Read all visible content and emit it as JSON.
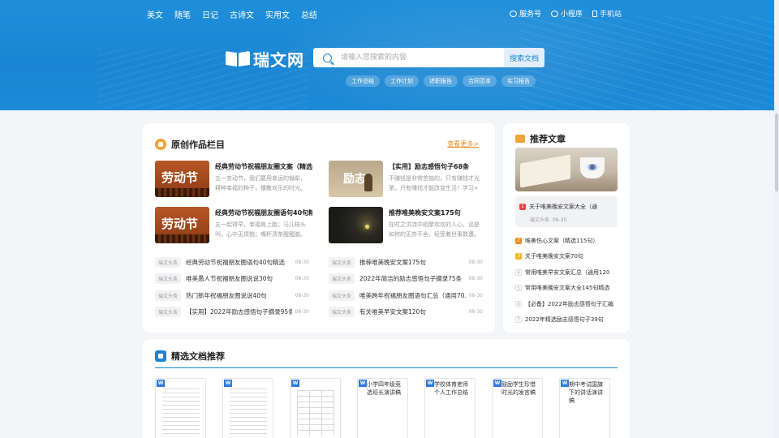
{
  "nav": {
    "left": [
      "美文",
      "随笔",
      "日记",
      "古诗文",
      "实用文",
      "总结"
    ],
    "right": [
      "服务号",
      "小程序",
      "手机站"
    ]
  },
  "brand": {
    "name": "瑞文网"
  },
  "search": {
    "placeholder": "请输入您搜索的内容",
    "button": "搜索文档"
  },
  "hot_tags": [
    "工作总结",
    "工作计划",
    "述职报告",
    "合同范本",
    "实习报告"
  ],
  "original": {
    "title": "原创作品栏目",
    "more": "查看更多>",
    "features": [
      {
        "title": "经典劳动节祝福朋友圈文案（精选",
        "desc": "五一劳动节，我们要用幸运的锄犁，耕种幸福的种子，播散欢乐的时光。",
        "thumb_text": "劳动节"
      },
      {
        "title": "【实用】励志感悟句子68条",
        "desc": "不赚钱是非常苦恼的，只有赚钱才光荣，只有赚钱才能改变生活！学习+",
        "thumb_text": "励志"
      },
      {
        "title": "经典劳动节祝福朋友圈语句40句精",
        "desc": "五一起得早，幸福肩上跑；马儿枝头叫，心中无烦恼；嘴杯清茶醒醒脑。",
        "thumb_text": "劳动节"
      },
      {
        "title": "推荐唯美晚安文案175句",
        "desc": "在时之洪流中相聚欢欢的人心，谈是如何的无奈不舍，经受着世事数遭。",
        "thumb_text": ""
      }
    ],
    "list_left": [
      {
        "badge": "瑞文头条",
        "title": "经典劳动节祝福朋友圈语句40句精选",
        "date": "08-30"
      },
      {
        "badge": "瑞文头条",
        "title": "唯美愚人节祝福朋友圈说说30句",
        "date": "08-30"
      },
      {
        "badge": "瑞文头条",
        "title": "热门新年祝福朋友圈说说40句",
        "date": "08-30"
      },
      {
        "badge": "瑞文头条",
        "title": "【实用】2022年励志感悟句子摘录95条",
        "date": "08-30"
      }
    ],
    "list_right": [
      {
        "badge": "瑞文头条",
        "title": "推荐唯美晚安文案175句",
        "date": "08-30"
      },
      {
        "badge": "瑞文头条",
        "title": "2022年简洁的励志感悟句子摘录75条",
        "date": "08-30"
      },
      {
        "badge": "瑞文头条",
        "title": "唯美跨年祝福朋友圈语句汇总（通用70...",
        "date": "08-30"
      },
      {
        "badge": "瑞文头条",
        "title": "有关唯美早安文案120句",
        "date": "08-30"
      }
    ]
  },
  "recommend": {
    "title": "推荐文章",
    "highlight": {
      "num": "1",
      "title": "关于唯美晚安文案大全（通",
      "source": "瑞文头条",
      "date": "08-30"
    },
    "items": [
      {
        "num": "2",
        "title": "唯美伤心文案（精选115句）"
      },
      {
        "num": "3",
        "title": "关于唯美晚安文案70句"
      },
      {
        "num": "4",
        "title": "常用唯美早安文案汇总（通用120"
      },
      {
        "num": "5",
        "title": "常用唯美晚安文案大全145句精选"
      },
      {
        "num": "6",
        "title": "【必备】2022年励志感悟句子汇编"
      },
      {
        "num": "7",
        "title": "2022年精选励志感悟句子39句"
      }
    ]
  },
  "docs": {
    "title": "精选文档推荐",
    "items": [
      {
        "title": ""
      },
      {
        "title": ""
      },
      {
        "title": ""
      },
      {
        "title": "小学四年级竞选班长演讲稿"
      },
      {
        "title": "学校体育老师个人工作总结"
      },
      {
        "title": "鼓励学生珍惜时光的发言稿"
      },
      {
        "title": "期中考试国旗下的讲话演讲稿"
      }
    ],
    "icon_letter": "W"
  }
}
